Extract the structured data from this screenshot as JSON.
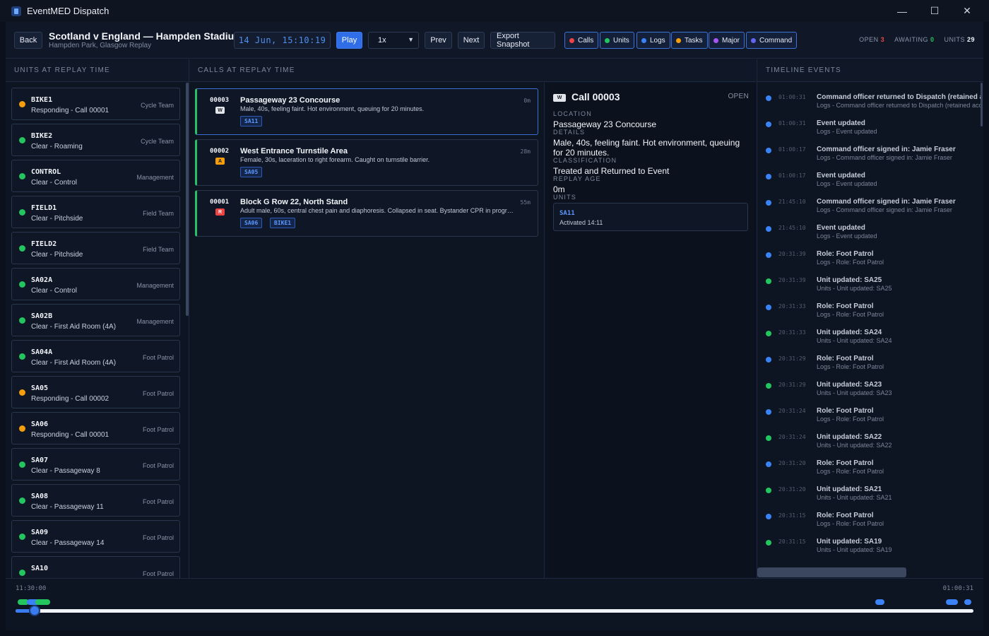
{
  "window": {
    "title": "EventMED Dispatch",
    "minimize": "—",
    "maximize": "☐",
    "close": "✕"
  },
  "toolbar": {
    "back": "Back",
    "event_title": "Scotland v England — Hampden Stadium",
    "event_subtitle": "Hampden Park, Glasgow Replay",
    "clock": "14 Jun, 15:10:19",
    "play": "Play",
    "speed": "1x",
    "prev": "Prev",
    "next": "Next",
    "export": "Export Snapshot",
    "filters": [
      {
        "label": "Calls",
        "color": "#ef4444"
      },
      {
        "label": "Units",
        "color": "#22c55e"
      },
      {
        "label": "Logs",
        "color": "#3b82f6"
      },
      {
        "label": "Tasks",
        "color": "#f59e0b"
      },
      {
        "label": "Major",
        "color": "#a855f7"
      },
      {
        "label": "Command",
        "color": "#6366f1"
      }
    ],
    "stats": {
      "open_label": "OPEN",
      "open_value": "3",
      "open_color": "#ef4444",
      "awaiting_label": "AWAITING",
      "awaiting_value": "0",
      "awaiting_color": "#22c55e",
      "units_label": "UNITS",
      "units_value": "29",
      "units_color": "#f2f5fa"
    }
  },
  "panels": {
    "units_heading": "UNITS AT REPLAY TIME",
    "calls_heading": "CALLS AT REPLAY TIME",
    "timeline_heading": "TIMELINE EVENTS"
  },
  "units": [
    {
      "name": "BIKE1",
      "status": "Responding - Call 00001",
      "role": "Cycle Team",
      "color": "#f59e0b"
    },
    {
      "name": "BIKE2",
      "status": "Clear - Roaming",
      "role": "Cycle Team",
      "color": "#22c55e"
    },
    {
      "name": "CONTROL",
      "status": "Clear - Control",
      "role": "Management",
      "color": "#22c55e"
    },
    {
      "name": "FIELD1",
      "status": "Clear - Pitchside",
      "role": "Field Team",
      "color": "#22c55e"
    },
    {
      "name": "FIELD2",
      "status": "Clear - Pitchside",
      "role": "Field Team",
      "color": "#22c55e"
    },
    {
      "name": "SA02A",
      "status": "Clear - Control",
      "role": "Management",
      "color": "#22c55e"
    },
    {
      "name": "SA02B",
      "status": "Clear - First Aid Room (4A)",
      "role": "Management",
      "color": "#22c55e"
    },
    {
      "name": "SA04A",
      "status": "Clear - First Aid Room (4A)",
      "role": "Foot Patrol",
      "color": "#22c55e"
    },
    {
      "name": "SA05",
      "status": "Responding - Call 00002",
      "role": "Foot Patrol",
      "color": "#f59e0b"
    },
    {
      "name": "SA06",
      "status": "Responding - Call 00001",
      "role": "Foot Patrol",
      "color": "#f59e0b"
    },
    {
      "name": "SA07",
      "status": "Clear - Passageway 8",
      "role": "Foot Patrol",
      "color": "#22c55e"
    },
    {
      "name": "SA08",
      "status": "Clear - Passageway 11",
      "role": "Foot Patrol",
      "color": "#22c55e"
    },
    {
      "name": "SA09",
      "status": "Clear - Passageway 14",
      "role": "Foot Patrol",
      "color": "#22c55e"
    },
    {
      "name": "SA10",
      "status": "",
      "role": "Foot Patrol",
      "color": "#22c55e"
    }
  ],
  "calls": [
    {
      "id": "00003",
      "tag": "W",
      "tag_bg": "#e2e5ea",
      "tag_fg": "#11151c",
      "title": "Passageway 23 Concourse",
      "desc": "Male, 40s, feeling faint. Hot environment, queuing for 20 minutes.",
      "age": "0m",
      "units": [
        "SA11"
      ]
    },
    {
      "id": "00002",
      "tag": "A",
      "tag_bg": "#f59e0b",
      "tag_fg": "#11151c",
      "title": "West Entrance Turnstile Area",
      "desc": "Female, 30s, laceration to right forearm. Caught on turnstile barrier.",
      "age": "28m",
      "units": [
        "SA05"
      ]
    },
    {
      "id": "00001",
      "tag": "R",
      "tag_bg": "#ef4444",
      "tag_fg": "#ffffff",
      "title": "Block G Row 22, North Stand",
      "desc": "Adult male, 60s, central chest pain and diaphoresis. Collapsed in seat. Bystander CPR in progress.",
      "age": "55m",
      "units": [
        "SA06",
        "BIKE1"
      ]
    }
  ],
  "detail": {
    "tag": "W",
    "title": "Call 00003",
    "state": "OPEN",
    "location_label": "LOCATION",
    "location": "Passageway 23 Concourse",
    "details_label": "DETAILS",
    "details": "Male, 40s, feeling faint. Hot environment, queuing for 20 minutes.",
    "classification_label": "CLASSIFICATION",
    "classification": "Treated and Returned to Event",
    "age_label": "REPLAY AGE",
    "age": "0m",
    "units_label": "UNITS",
    "unit_name": "SA11",
    "unit_activated": "Activated 14:11"
  },
  "timeline": [
    {
      "time": "01:00:31",
      "title": "Command officer returned to Dispatch (retained access)",
      "sub": "Logs - Command officer returned to Dispatch (retained access)",
      "color": "#3b82f6"
    },
    {
      "time": "01:00:31",
      "title": "Event updated",
      "sub": "Logs - Event updated",
      "color": "#3b82f6"
    },
    {
      "time": "01:00:17",
      "title": "Command officer signed in: Jamie Fraser",
      "sub": "Logs - Command officer signed in: Jamie Fraser",
      "color": "#3b82f6"
    },
    {
      "time": "01:00:17",
      "title": "Event updated",
      "sub": "Logs - Event updated",
      "color": "#3b82f6"
    },
    {
      "time": "21:45:10",
      "title": "Command officer signed in: Jamie Fraser",
      "sub": "Logs - Command officer signed in: Jamie Fraser",
      "color": "#3b82f6"
    },
    {
      "time": "21:45:10",
      "title": "Event updated",
      "sub": "Logs - Event updated",
      "color": "#3b82f6"
    },
    {
      "time": "20:31:39",
      "title": "Role: Foot Patrol",
      "sub": "Logs - Role: Foot Patrol",
      "color": "#3b82f6"
    },
    {
      "time": "20:31:39",
      "title": "Unit updated: SA25",
      "sub": "Units - Unit updated: SA25",
      "color": "#22c55e"
    },
    {
      "time": "20:31:33",
      "title": "Role: Foot Patrol",
      "sub": "Logs - Role: Foot Patrol",
      "color": "#3b82f6"
    },
    {
      "time": "20:31:33",
      "title": "Unit updated: SA24",
      "sub": "Units - Unit updated: SA24",
      "color": "#22c55e"
    },
    {
      "time": "20:31:29",
      "title": "Role: Foot Patrol",
      "sub": "Logs - Role: Foot Patrol",
      "color": "#3b82f6"
    },
    {
      "time": "20:31:29",
      "title": "Unit updated: SA23",
      "sub": "Units - Unit updated: SA23",
      "color": "#22c55e"
    },
    {
      "time": "20:31:24",
      "title": "Role: Foot Patrol",
      "sub": "Logs - Role: Foot Patrol",
      "color": "#3b82f6"
    },
    {
      "time": "20:31:24",
      "title": "Unit updated: SA22",
      "sub": "Units - Unit updated: SA22",
      "color": "#22c55e"
    },
    {
      "time": "20:31:20",
      "title": "Role: Foot Patrol",
      "sub": "Logs - Role: Foot Patrol",
      "color": "#3b82f6"
    },
    {
      "time": "20:31:20",
      "title": "Unit updated: SA21",
      "sub": "Units - Unit updated: SA21",
      "color": "#22c55e"
    },
    {
      "time": "20:31:15",
      "title": "Role: Foot Patrol",
      "sub": "Logs - Role: Foot Patrol",
      "color": "#3b82f6"
    },
    {
      "time": "20:31:15",
      "title": "Unit updated: SA19",
      "sub": "Units - Unit updated: SA19",
      "color": "#22c55e"
    }
  ],
  "scrubber": {
    "start": "11:30:00",
    "end": "01:00:31",
    "position": 0.02
  }
}
